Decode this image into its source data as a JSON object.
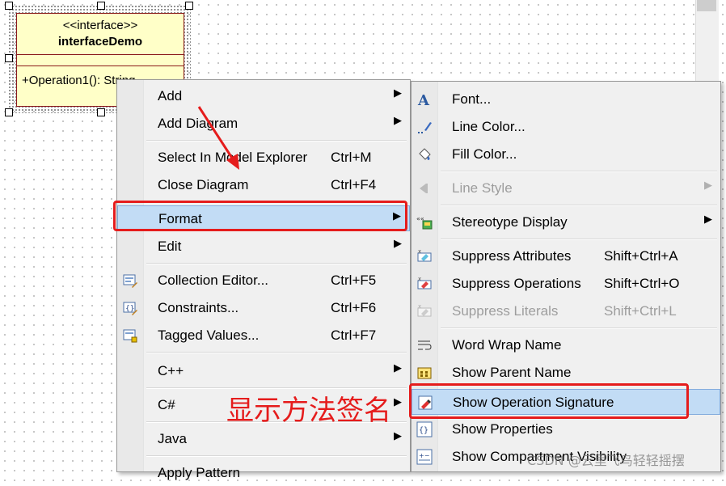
{
  "uml": {
    "stereotype": "<<interface>>",
    "name": "interfaceDemo",
    "operation": "+Operation1(): String"
  },
  "menu_primary": {
    "items": [
      {
        "label": "Add",
        "submenu": true
      },
      {
        "label": "Add Diagram",
        "submenu": true
      },
      {
        "label": "Select In Model Explorer",
        "shortcut": "Ctrl+M"
      },
      {
        "label": "Close Diagram",
        "shortcut": "Ctrl+F4"
      },
      {
        "label": "Format",
        "submenu": true,
        "highlighted": true
      },
      {
        "label": "Edit",
        "submenu": true
      },
      {
        "label": "Collection Editor...",
        "shortcut": "Ctrl+F5",
        "icon": "collection-editor-icon"
      },
      {
        "label": "Constraints...",
        "shortcut": "Ctrl+F6",
        "icon": "constraints-icon"
      },
      {
        "label": "Tagged Values...",
        "shortcut": "Ctrl+F7",
        "icon": "tagged-values-icon"
      },
      {
        "label": "C++",
        "submenu": true
      },
      {
        "label": "C#",
        "submenu": true
      },
      {
        "label": "Java",
        "submenu": true
      },
      {
        "label": "Apply Pattern"
      }
    ]
  },
  "menu_format": {
    "items": [
      {
        "label": "Font...",
        "icon": "font-icon"
      },
      {
        "label": "Line Color...",
        "icon": "line-color-icon"
      },
      {
        "label": "Fill Color...",
        "icon": "fill-color-icon"
      },
      {
        "label": "Line Style",
        "submenu": true,
        "disabled": true,
        "icon": "line-style-icon"
      },
      {
        "label": "Stereotype Display",
        "submenu": true,
        "icon": "stereotype-display-icon"
      },
      {
        "label": "Suppress Attributes",
        "shortcut": "Shift+Ctrl+A",
        "icon": "suppress-attributes-icon"
      },
      {
        "label": "Suppress Operations",
        "shortcut": "Shift+Ctrl+O",
        "icon": "suppress-operations-icon"
      },
      {
        "label": "Suppress Literals",
        "shortcut": "Shift+Ctrl+L",
        "disabled": true,
        "icon": "suppress-literals-icon"
      },
      {
        "label": "Word Wrap Name",
        "icon": "word-wrap-icon"
      },
      {
        "label": "Show Parent Name",
        "icon": "show-parent-icon"
      },
      {
        "label": "Show Operation Signature",
        "highlighted": true,
        "icon": "operation-signature-icon"
      },
      {
        "label": "Show Properties",
        "icon": "show-properties-icon"
      },
      {
        "label": "Show Compartment Visibility",
        "icon": "compartment-visibility-icon"
      }
    ]
  },
  "annotation": "显示方法签名",
  "watermark": "CSDN @云里飞鸟轻轻摇摆",
  "colors": {
    "highlight": "#c2dcf5",
    "annotation": "#e51c1c",
    "uml_fill": "#ffffc8",
    "uml_border": "#8b1a1a"
  }
}
